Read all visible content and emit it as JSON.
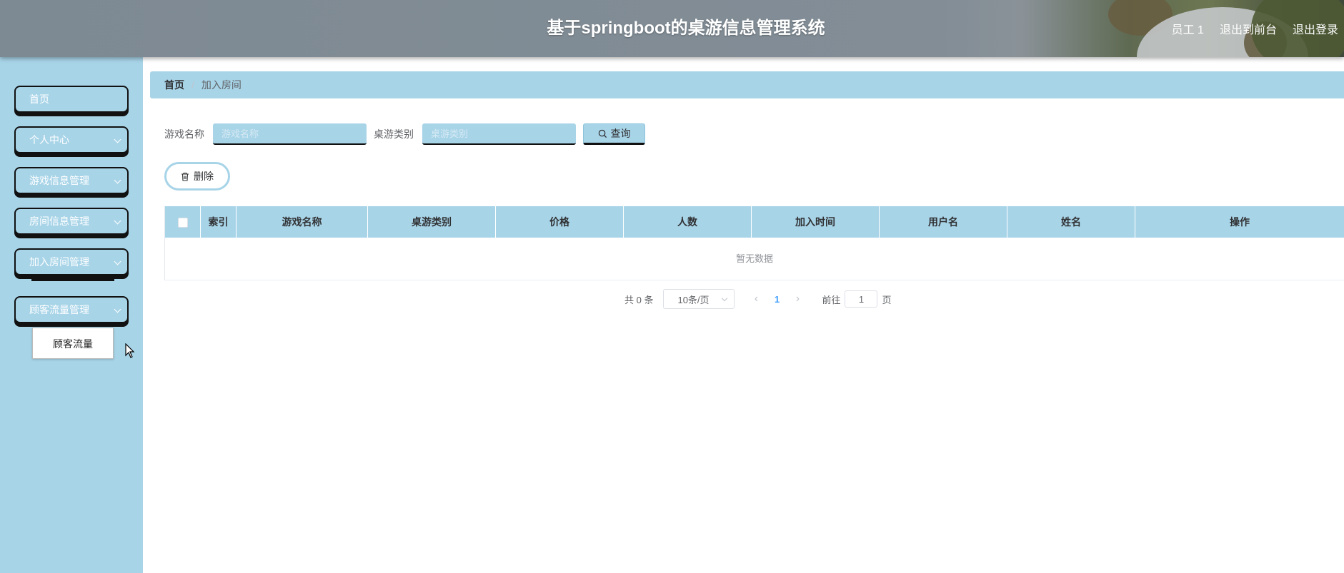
{
  "header": {
    "title": "基于springboot的桌游信息管理系统",
    "user": "员工 1",
    "to_front_label": "退出到前台",
    "logout_label": "退出登录"
  },
  "sidebar": {
    "items": [
      {
        "label": "首页",
        "has_arrow": false
      },
      {
        "label": "个人中心",
        "has_arrow": true
      },
      {
        "label": "游戏信息管理",
        "has_arrow": true
      },
      {
        "label": "房间信息管理",
        "has_arrow": true
      },
      {
        "label": "加入房间管理",
        "has_arrow": true
      },
      {
        "label": "顾客流量管理",
        "has_arrow": true
      }
    ],
    "popup_item": "顾客流量"
  },
  "breadcrumb": {
    "home": "首页",
    "current": "加入房间"
  },
  "search": {
    "game_name_label": "游戏名称",
    "game_name_placeholder": "游戏名称",
    "category_label": "桌游类别",
    "category_placeholder": "桌游类别",
    "query_label": "查询"
  },
  "actions": {
    "delete_label": "删除"
  },
  "table": {
    "columns": [
      "索引",
      "游戏名称",
      "桌游类别",
      "价格",
      "人数",
      "加入时间",
      "用户名",
      "姓名",
      "操作"
    ],
    "empty_text": "暂无数据"
  },
  "pagination": {
    "total": "共 0 条",
    "page_size": "10条/页",
    "current_page": "1",
    "goto_label": "前往",
    "goto_value": "1",
    "page_suffix": "页"
  },
  "colors": {
    "accent": "#a8d4e8",
    "header_bg": "#808b94",
    "border_dark": "#111111"
  }
}
